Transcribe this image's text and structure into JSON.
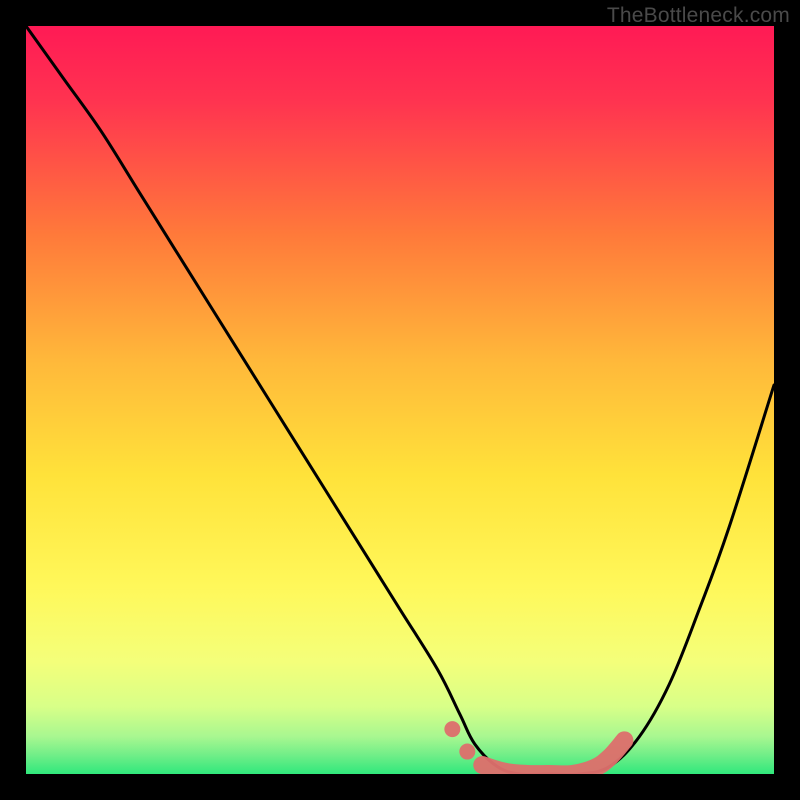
{
  "watermark": "TheBottleneck.com",
  "colors": {
    "bg": "#000000",
    "gradient_top": "#ff1a4d",
    "gradient_mid1": "#ff6a3a",
    "gradient_mid2": "#ffd93a",
    "gradient_mid3": "#f8ff66",
    "gradient_mid4": "#d8ff80",
    "gradient_bottom": "#30e87c",
    "curve": "#000000",
    "highlight": "#e06666"
  },
  "chart_data": {
    "type": "line",
    "title": "",
    "xlabel": "",
    "ylabel": "",
    "xlim": [
      0,
      100
    ],
    "ylim": [
      0,
      100
    ],
    "series": [
      {
        "name": "bottleneck-curve",
        "x": [
          0,
          5,
          10,
          15,
          20,
          25,
          30,
          35,
          40,
          45,
          50,
          55,
          58,
          60,
          63,
          66,
          70,
          74,
          78,
          82,
          86,
          90,
          94,
          100
        ],
        "y": [
          100,
          93,
          86,
          78,
          70,
          62,
          54,
          46,
          38,
          30,
          22,
          14,
          8,
          4,
          1,
          0,
          0,
          0,
          1,
          5,
          12,
          22,
          33,
          52
        ]
      }
    ],
    "highlight_segment": {
      "name": "optimal-range",
      "x": [
        57,
        59,
        61,
        64,
        67,
        70,
        73,
        76,
        78,
        80
      ],
      "y": [
        6,
        3,
        1.2,
        0.3,
        0,
        0,
        0,
        0.8,
        2.2,
        4.5
      ]
    }
  }
}
